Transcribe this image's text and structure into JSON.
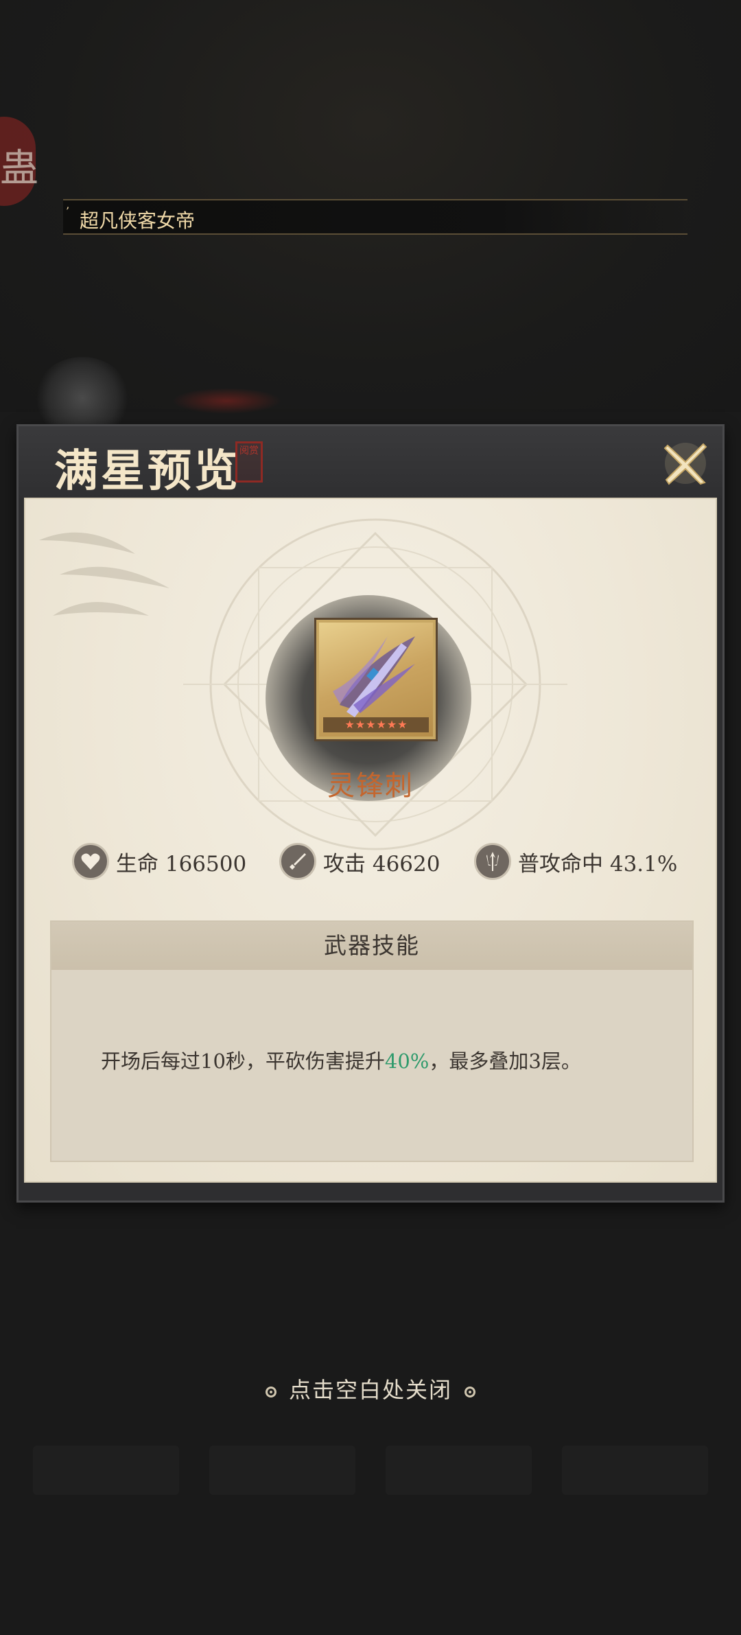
{
  "background": {
    "seal_char": "蛊",
    "banner_text": "超凡侠客女帝"
  },
  "modal": {
    "title": "满星预览",
    "title_seal": "阅赏",
    "close_icon": "close-x-icon",
    "item": {
      "name": "灵锋刺",
      "stars": 6,
      "icon": "purple-blade-icon"
    },
    "stats": [
      {
        "icon": "heart-icon",
        "text": "生命 166500"
      },
      {
        "icon": "sword-icon",
        "text": "攻击 46620"
      },
      {
        "icon": "trident-icon",
        "text": "普攻命中 43.1%"
      }
    ],
    "skill": {
      "header": "武器技能",
      "desc_before": "开场后每过10秒，平砍伤害提升",
      "desc_highlight": "40%",
      "desc_after": "，最多叠加3层。"
    }
  },
  "hint": "点击空白处关闭",
  "colors": {
    "item_name": "#c4662e",
    "highlight": "#2f9a6c",
    "title": "#f4e6c8"
  }
}
